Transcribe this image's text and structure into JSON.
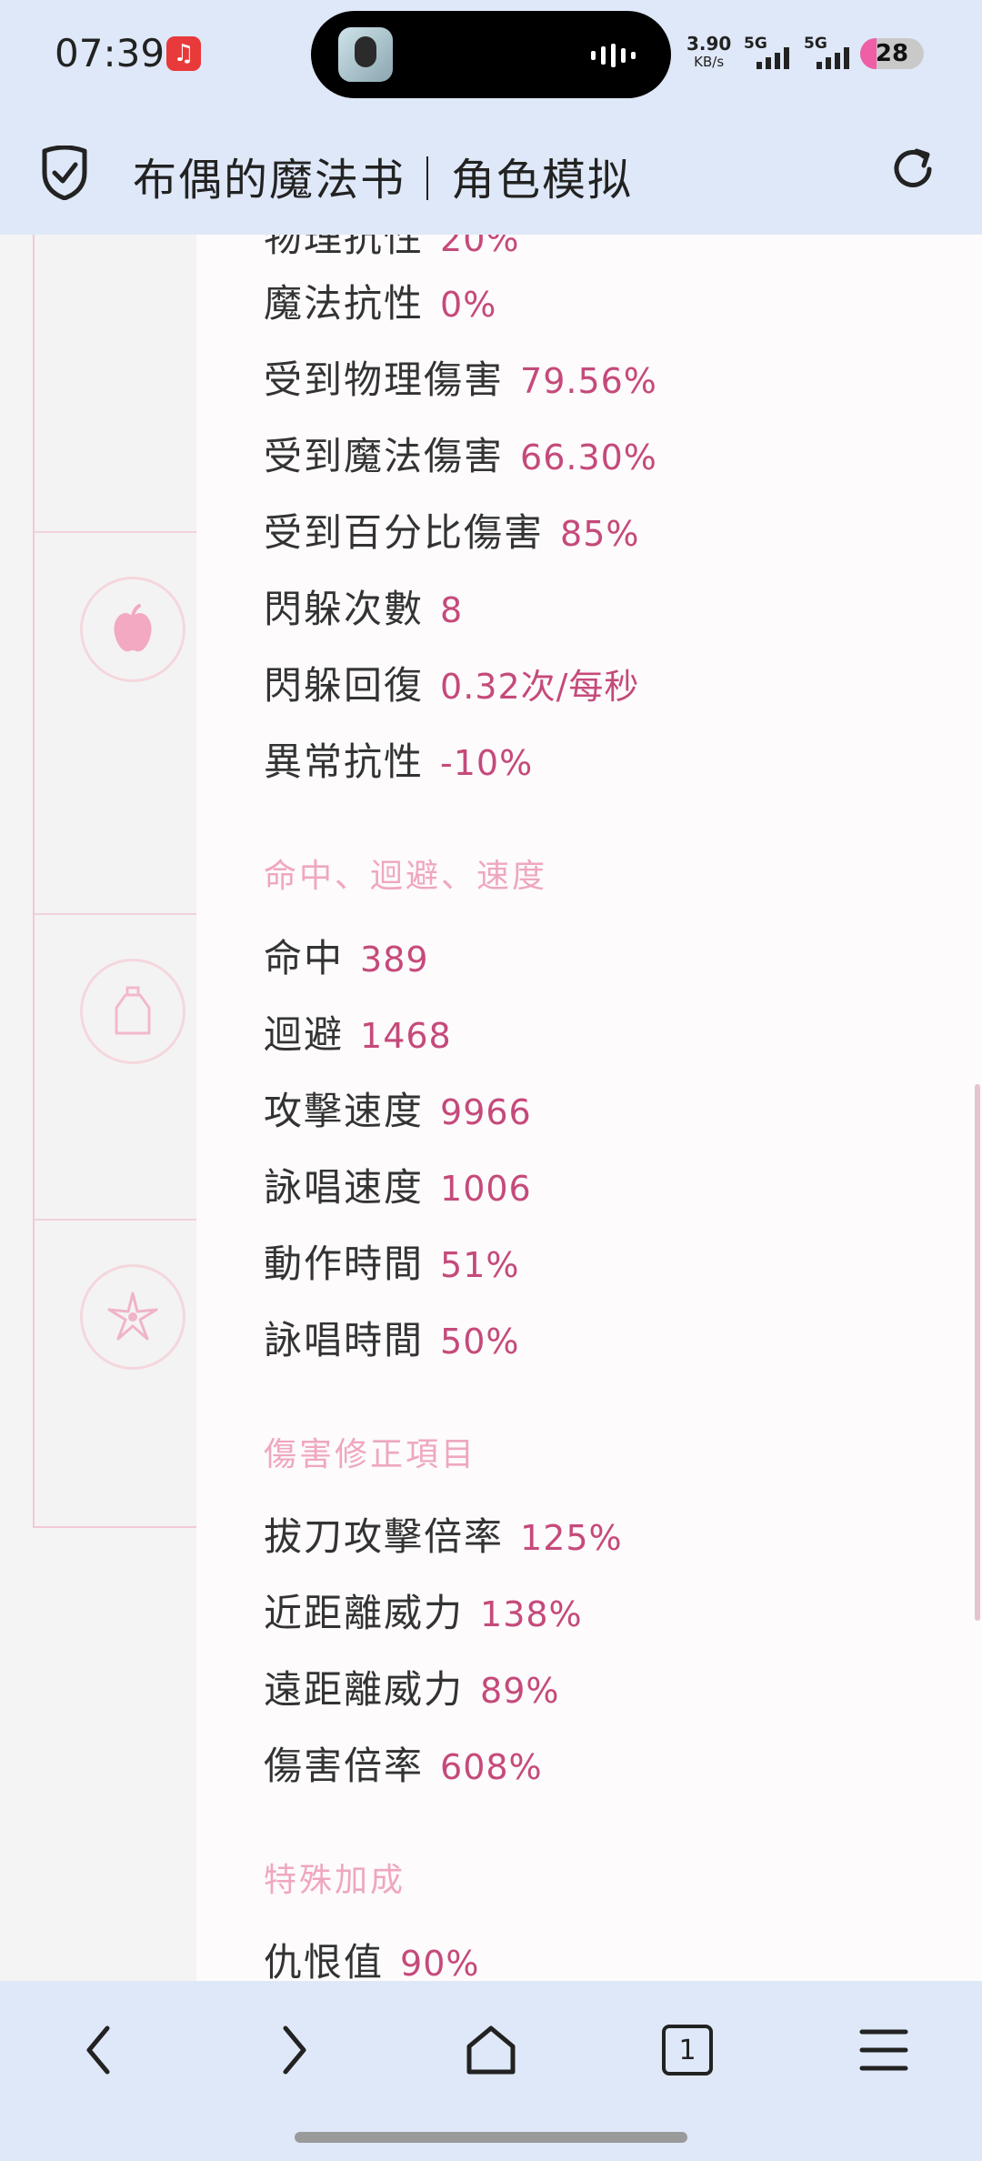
{
  "status_bar": {
    "time": "07:39",
    "net_speed": "3.90",
    "net_unit": "KB/s",
    "sim1": "5G",
    "sim2": "5G",
    "battery": "28"
  },
  "app_bar": {
    "title": "布偶的魔法书｜角色模拟",
    "shield_icon": "shield-check-icon",
    "reload_icon": "reload-icon"
  },
  "sidebar": {
    "icons": [
      "apple-icon",
      "potion-bottle-icon",
      "flower-star-icon"
    ]
  },
  "stats": {
    "resist": [
      {
        "label": "魔法抗性",
        "value": "0%"
      },
      {
        "label": "受到物理傷害",
        "value": "79.56%"
      },
      {
        "label": "受到魔法傷害",
        "value": "66.30%"
      },
      {
        "label": "受到百分比傷害",
        "value": "85%"
      },
      {
        "label": "閃躲次數",
        "value": "8"
      },
      {
        "label": "閃躲回復",
        "value": "0.32次/每秒"
      },
      {
        "label": "異常抗性",
        "value": "-10%"
      }
    ],
    "section_speed": "命中、迴避、速度",
    "speed": [
      {
        "label": "命中",
        "value": "389"
      },
      {
        "label": "迴避",
        "value": "1468"
      },
      {
        "label": "攻擊速度",
        "value": "9966"
      },
      {
        "label": "詠唱速度",
        "value": "1006"
      },
      {
        "label": "動作時間",
        "value": "51%"
      },
      {
        "label": "詠唱時間",
        "value": "50%"
      }
    ],
    "section_damage": "傷害修正項目",
    "damage": [
      {
        "label": "拔刀攻擊倍率",
        "value": "125%"
      },
      {
        "label": "近距離威力",
        "value": "138%"
      },
      {
        "label": "遠距離威力",
        "value": "89%"
      },
      {
        "label": "傷害倍率",
        "value": "608%"
      }
    ],
    "section_special": "特殊加成",
    "special": [
      {
        "label": "仇恨值",
        "value": "90%"
      }
    ]
  },
  "nav_bar": {
    "tab_count": "1",
    "icons": [
      "back-icon",
      "forward-icon",
      "home-icon",
      "tabs-icon",
      "menu-icon"
    ]
  },
  "colors": {
    "accent_value": "#c54a7b",
    "section_heading": "#efa7bf",
    "bar_background": "#dfe8f8"
  }
}
